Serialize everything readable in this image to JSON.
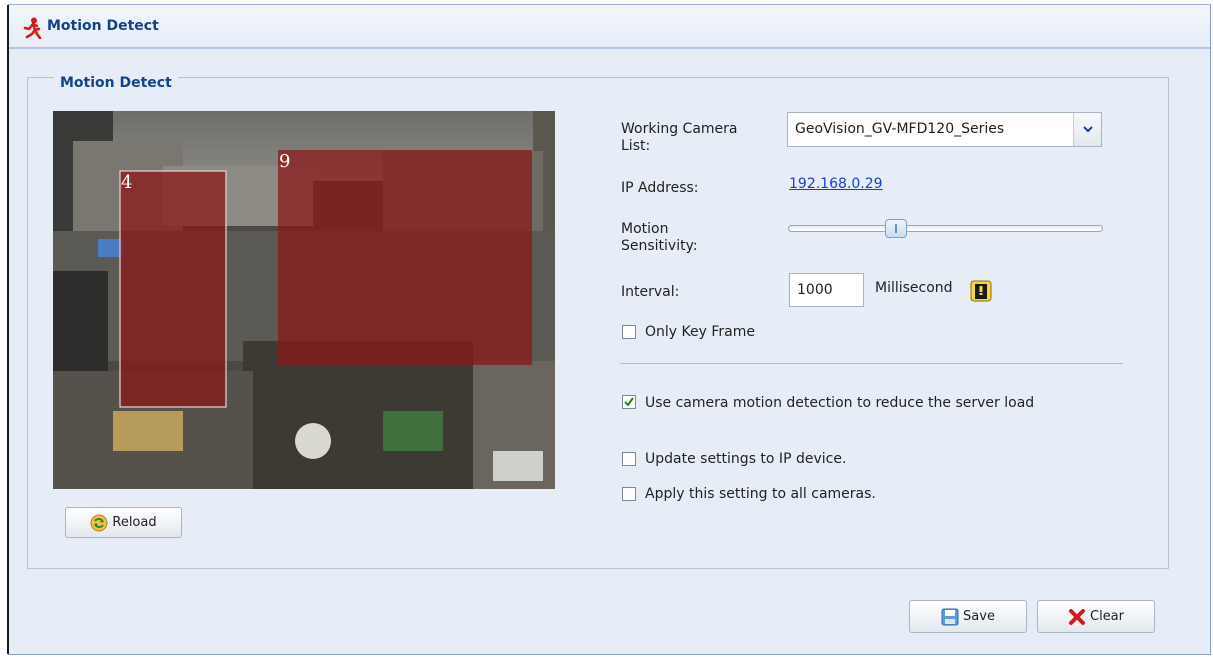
{
  "window": {
    "title": "Motion Detect"
  },
  "group": {
    "legend": "Motion Detect"
  },
  "camera": {
    "zones": [
      {
        "id": "4"
      },
      {
        "id": "9"
      }
    ],
    "zone_color": "#8b1616"
  },
  "buttons": {
    "reload": "Reload",
    "save": "Save",
    "clear": "Clear"
  },
  "form": {
    "camera_list_label": "Working Camera List:",
    "camera_list_value": "GeoVision_GV-MFD120_Series",
    "ip_label": "IP Address:",
    "ip_value": "192.168.0.29",
    "sensitivity_label": "Motion Sensitivity:",
    "sensitivity_level": 0.33,
    "interval_label": "Interval:",
    "interval_value": "1000",
    "interval_unit": "Millisecond",
    "only_key_frame": {
      "label": "Only Key Frame",
      "checked": false
    },
    "use_camera_md": {
      "label": "Use camera motion detection to reduce the server load",
      "checked": true
    },
    "update_settings": {
      "label": "Update settings to IP device.",
      "checked": false
    },
    "apply_all": {
      "label": "Apply this setting to all cameras.",
      "checked": false
    }
  },
  "colors": {
    "title": "#15428b",
    "link": "#1a3fd3",
    "background": "#e6edf6"
  }
}
